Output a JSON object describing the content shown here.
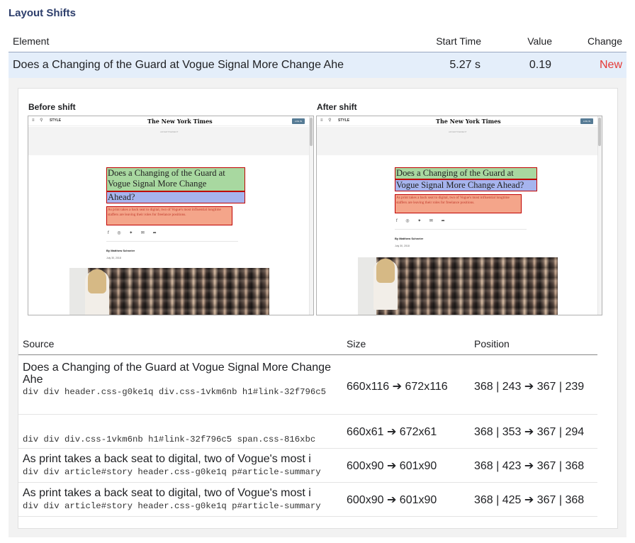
{
  "title": "Layout Shifts",
  "summary": {
    "headers": {
      "element": "Element",
      "start_time": "Start Time",
      "value": "Value",
      "change": "Change"
    },
    "row": {
      "element": "Does a Changing of the Guard at Vogue Signal More Change Ahe",
      "start_time": "5.27 s",
      "value": "0.19",
      "change": "New",
      "change_color": "#e53935"
    }
  },
  "before": {
    "label": "Before shift",
    "headline_green": [
      "Does a Changing of the Guard at",
      "Vogue Signal More Change"
    ],
    "headline_blue": "Ahead?",
    "summary": "As print takes a back seat to digital, two of Vogue's most influential longtime staffers are leaving their roles for freelance positions."
  },
  "after": {
    "label": "After shift",
    "headline_green": "Does a Changing of the Guard at",
    "headline_blue": "Vogue Signal More Change Ahead?",
    "summary": "As print takes a back seat to digital, two of Vogue's most influential longtime staffers are leaving their roles for freelance positions."
  },
  "page_preview": {
    "section": "STYLE",
    "logo": "The New York Times",
    "login": "LOG IN",
    "ad_text": "ADVERTISEMENT",
    "byline": "By Matthew Schneier",
    "date": "July 30, 2018",
    "nav_icons": [
      "menu-icon",
      "search-icon"
    ],
    "social_icons": [
      "facebook-icon",
      "whatsapp-icon",
      "twitter-icon",
      "email-icon",
      "share-icon"
    ]
  },
  "sources": {
    "headers": {
      "source": "Source",
      "size": "Size",
      "position": "Position"
    },
    "rows": [
      {
        "text": "Does a Changing of the Guard at Vogue Signal More Change Ahe",
        "selector": "div div header.css-g0ke1q div.css-1vkm6nb h1#link-32f796c5",
        "size": "660x116 ➔ 672x116",
        "position": "368 | 243 ➔ 367 | 239"
      },
      {
        "text": "",
        "selector": "div div div.css-1vkm6nb h1#link-32f796c5 span.css-816xbc",
        "size": "660x61 ➔ 672x61",
        "position": "368 | 353 ➔ 367 | 294"
      },
      {
        "text": "As print takes a back seat to digital, two of Vogue's most i",
        "selector": "div div article#story header.css-g0ke1q p#article-summary",
        "size": "600x90 ➔ 601x90",
        "position": "368 | 423 ➔ 367 | 368"
      },
      {
        "text": "As print takes a back seat to digital, two of Vogue's most i",
        "selector": "div div article#story header.css-g0ke1q p#article-summary",
        "size": "600x90 ➔ 601x90",
        "position": "368 | 425 ➔ 367 | 368"
      }
    ]
  }
}
